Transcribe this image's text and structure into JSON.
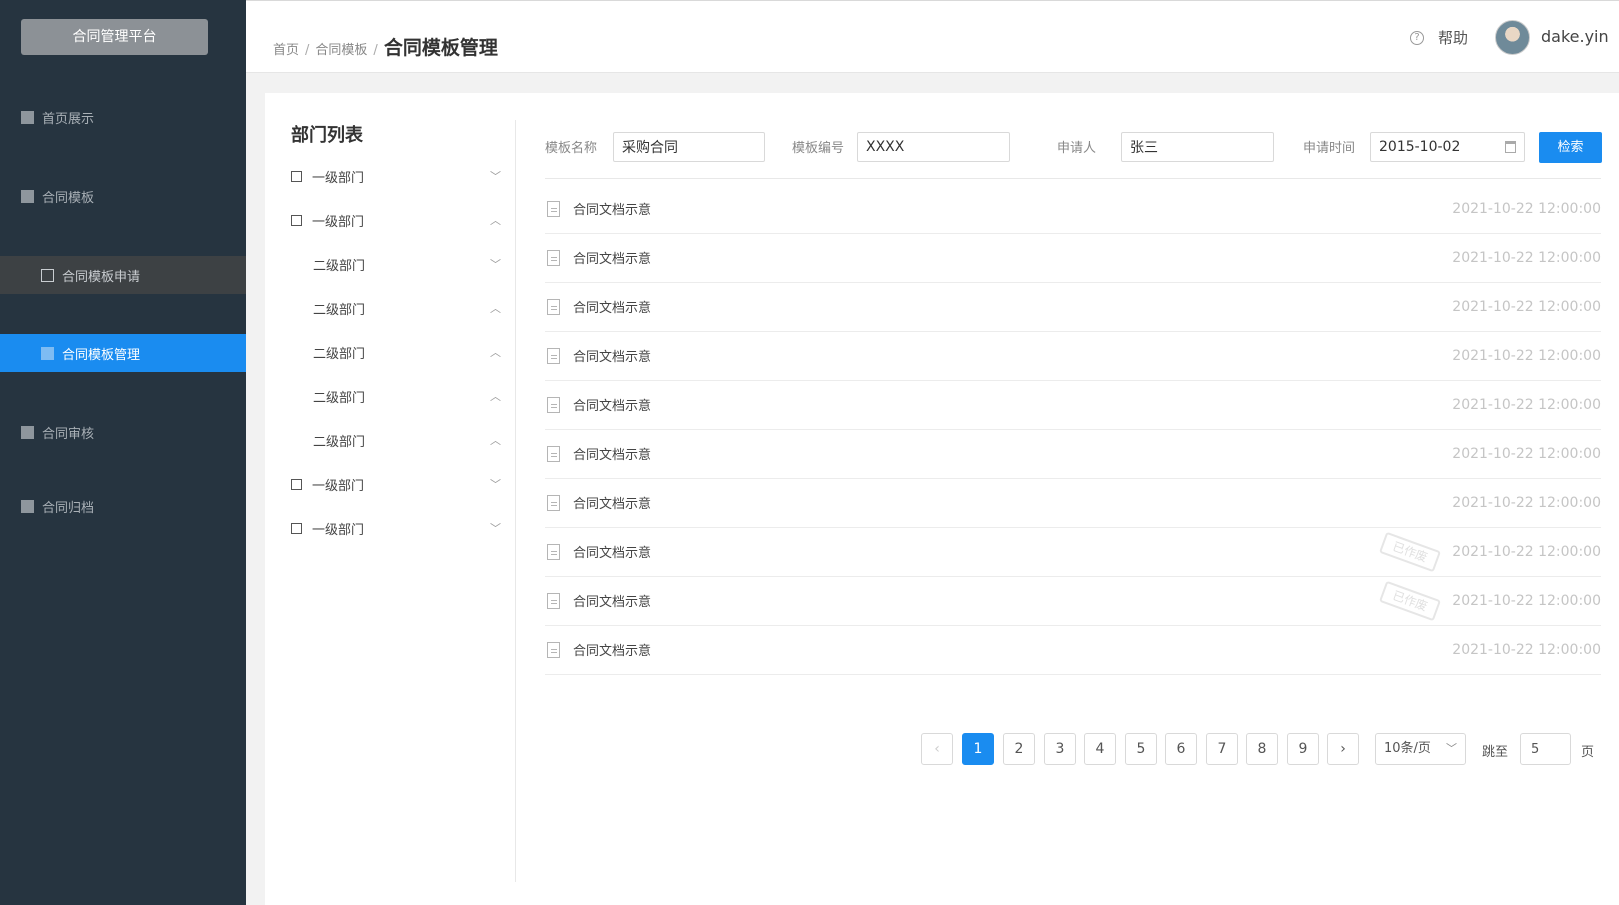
{
  "sidebar": {
    "brand": "合同管理平台",
    "items": [
      {
        "label": "首页展示"
      },
      {
        "label": "合同模板"
      },
      {
        "label": "合同模板申请"
      },
      {
        "label": "合同模板管理"
      },
      {
        "label": "合同审核"
      },
      {
        "label": "合同归档"
      }
    ]
  },
  "header": {
    "breadcrumb": [
      "首页",
      "合同模板",
      "合同模板管理"
    ],
    "separator": "/",
    "help": "帮助",
    "help_icon": "?",
    "user": "dake.yin"
  },
  "departments": {
    "title": "部门列表",
    "items": [
      {
        "label": "一级部门",
        "chevron": "﹀"
      },
      {
        "label": "一级部门",
        "chevron": "︿"
      },
      {
        "label": "二级部门",
        "chevron": "﹀"
      },
      {
        "label": "二级部门",
        "chevron": "︿"
      },
      {
        "label": "二级部门",
        "chevron": "︿"
      },
      {
        "label": "二级部门",
        "chevron": "︿"
      },
      {
        "label": "二级部门",
        "chevron": "︿"
      },
      {
        "label": "一级部门",
        "chevron": "﹀"
      },
      {
        "label": "一级部门",
        "chevron": "﹀"
      }
    ]
  },
  "filters": {
    "template_name_label": "模板名称",
    "template_name_value": "采购合同",
    "template_code_label": "模板编号",
    "template_code_value": "XXXX",
    "applicant_label": "申请人",
    "applicant_value": "张三",
    "apply_time_label": "申请时间",
    "apply_time_value": "2015-10-02",
    "search_button": "检索"
  },
  "list": {
    "rows": [
      {
        "name": "合同文档示意",
        "time": "2021-10-22 12:00:00"
      },
      {
        "name": "合同文档示意",
        "time": "2021-10-22 12:00:00"
      },
      {
        "name": "合同文档示意",
        "time": "2021-10-22 12:00:00"
      },
      {
        "name": "合同文档示意",
        "time": "2021-10-22 12:00:00"
      },
      {
        "name": "合同文档示意",
        "time": "2021-10-22 12:00:00"
      },
      {
        "name": "合同文档示意",
        "time": "2021-10-22 12:00:00"
      },
      {
        "name": "合同文档示意",
        "time": "2021-10-22 12:00:00"
      },
      {
        "name": "合同文档示意",
        "time": "2021-10-22 12:00:00",
        "stamp": "已作废"
      },
      {
        "name": "合同文档示意",
        "time": "2021-10-22 12:00:00",
        "stamp": "已作废"
      },
      {
        "name": "合同文档示意",
        "time": "2021-10-22 12:00:00"
      }
    ]
  },
  "pagination": {
    "prev": "‹",
    "next": "›",
    "pages": [
      "1",
      "2",
      "3",
      "4",
      "5",
      "6",
      "7",
      "8",
      "9"
    ],
    "current": "1",
    "page_size": "10条/页",
    "page_size_arrow": "﹀",
    "jump_label": "跳至",
    "jump_value": "5",
    "page_suffix": "页"
  },
  "colors": {
    "sidebar_bg": "#263440",
    "accent": "#1a8cf0"
  }
}
